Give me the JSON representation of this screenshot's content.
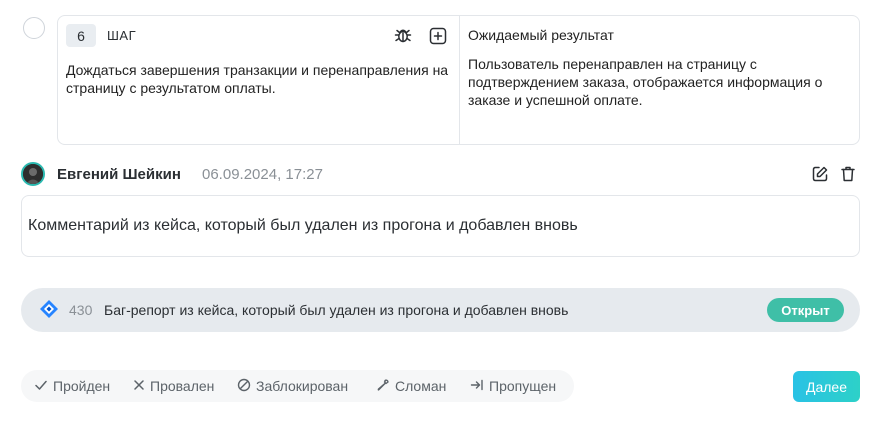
{
  "step": {
    "number": "6",
    "label": "ШАГ",
    "text": "Дождаться завершения транзакции и перенаправления на страницу с результатом оплаты.",
    "expected_title": "Ожидаемый результат",
    "expected_text": "Пользователь перенаправлен на страницу с подтверждением заказа, отображается информация о заказе и успешной оплате.",
    "icons": [
      "bug-icon",
      "add-box-icon"
    ]
  },
  "comment": {
    "author": "Евгений Шейкин",
    "date": "06.09.2024, 17:27",
    "text": "Комментарий из кейса, который был удален из прогона и добавлен вновь",
    "icons": [
      "edit-icon",
      "delete-icon"
    ]
  },
  "bug": {
    "id": "430",
    "title": "Баг-репорт из кейса, который был удален из прогона и добавлен вновь",
    "status": "Открыт",
    "status_color": "#3fbfa7"
  },
  "status_buttons": [
    {
      "label": "Пройден",
      "icon": "check-icon"
    },
    {
      "label": "Провален",
      "icon": "cross-icon"
    },
    {
      "label": "Заблокирован",
      "icon": "blocked-icon"
    },
    {
      "label": "Сломан",
      "icon": "wrench-icon"
    },
    {
      "label": "Пропущен",
      "icon": "skip-icon"
    }
  ],
  "next_button": "Далее",
  "colors": {
    "accent": "#29c2e5",
    "accent_end": "#2dd1c8",
    "border": "#e3e6ea",
    "muted_text": "#8a9096"
  }
}
